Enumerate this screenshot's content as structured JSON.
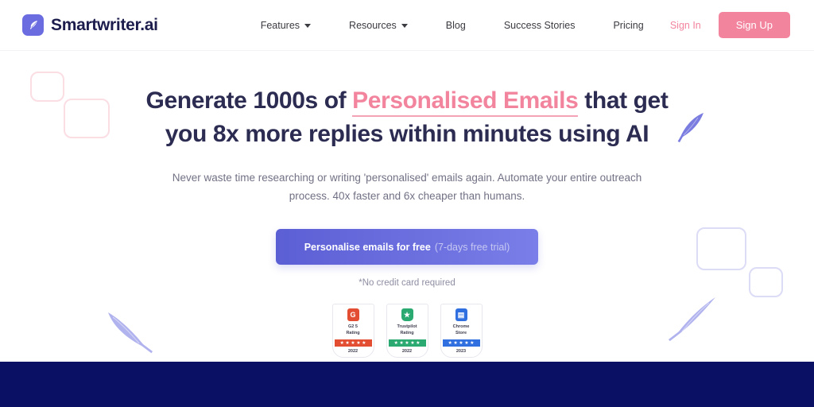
{
  "brand": {
    "name": "Smartwriter.ai",
    "logo_icon": "feather-icon",
    "logo_bg": "#6a6ce0"
  },
  "nav": {
    "items": [
      {
        "label": "Features",
        "has_chevron": true
      },
      {
        "label": "Resources",
        "has_chevron": true
      },
      {
        "label": "Blog",
        "has_chevron": false
      },
      {
        "label": "Success Stories",
        "has_chevron": false
      },
      {
        "label": "Pricing",
        "has_chevron": false
      }
    ]
  },
  "auth": {
    "sign_in": "Sign In",
    "sign_up": "Sign Up",
    "accent": "#f2849e"
  },
  "hero": {
    "headline_part1": "Generate 1000s of ",
    "headline_highlight": "Personalised Emails",
    "headline_part2": " that get",
    "headline_line2": "you 8x more replies within minutes using AI",
    "subhead_line1": "Never waste time researching or writing 'personalised' emails again. Automate your entire outreach",
    "subhead_line2": "process. 40x faster and 6x cheaper than humans.",
    "cta_main": "Personalise emails for free",
    "cta_sub": "(7-days free trial)",
    "no_card": "*No credit card required",
    "highlight_color": "#f2849e",
    "cta_color": "#5b5fd4"
  },
  "badges": [
    {
      "logo_text": "G",
      "logo_icon": "g2-icon",
      "title_line1": "G2 5",
      "title_line2": "Rating",
      "stars": 5,
      "year": "2022",
      "color": "#e34e32"
    },
    {
      "logo_text": "★",
      "logo_icon": "trustpilot-icon",
      "title_line1": "Trustpilot",
      "title_line2": "Rating",
      "stars": 5,
      "year": "2022",
      "color": "#2aa971"
    },
    {
      "logo_text": "▤",
      "logo_icon": "chrome-store-icon",
      "title_line1": "Chrome",
      "title_line2": "Store",
      "stars": 5,
      "year": "2023",
      "color": "#2f6fe0"
    }
  ],
  "decorations": {
    "pink_square_color": "#fbdde4",
    "purple_square_color": "#dcdcf6",
    "feather_color": "#9a9ce8",
    "band_color": "#0a1064"
  }
}
